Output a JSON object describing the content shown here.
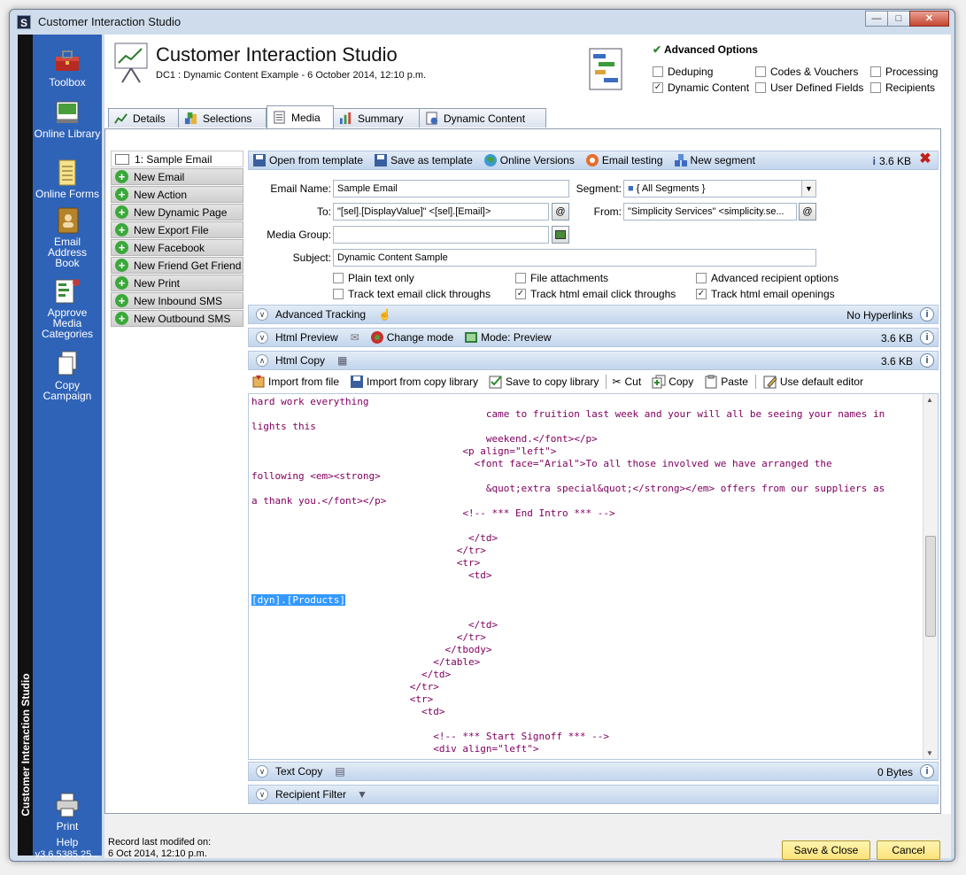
{
  "window": {
    "title": "Customer Interaction Studio"
  },
  "sidebar": {
    "vertical_title": "Customer Interaction Studio",
    "items": [
      {
        "label": "Toolbox",
        "icon": "toolbox-icon"
      },
      {
        "label": "Online Library",
        "icon": "library-icon"
      },
      {
        "label": "Online Forms",
        "icon": "forms-icon"
      },
      {
        "label": "Email Address Book",
        "icon": "address-book-icon"
      },
      {
        "label": "Approve Media Categories",
        "icon": "approve-icon"
      },
      {
        "label": "Copy Campaign",
        "icon": "copy-campaign-icon"
      }
    ],
    "print_label": "Print",
    "help_label": "Help",
    "version": "v3.6.5385.25..."
  },
  "header": {
    "title": "Customer Interaction Studio",
    "subtitle": "DC1 : Dynamic Content Example - 6 October 2014, 12:10 p.m.",
    "advanced_options": {
      "title": "Advanced Options",
      "options": [
        {
          "label": "Deduping",
          "checked": false
        },
        {
          "label": "Codes & Vouchers",
          "checked": false
        },
        {
          "label": "Processing",
          "checked": false
        },
        {
          "label": "Dynamic Content",
          "checked": true
        },
        {
          "label": "User Defined Fields",
          "checked": false
        },
        {
          "label": "Recipients",
          "checked": false
        }
      ]
    }
  },
  "tabs": [
    {
      "label": "Details",
      "active": false
    },
    {
      "label": "Selections",
      "active": false
    },
    {
      "label": "Media",
      "active": true
    },
    {
      "label": "Summary",
      "active": false
    },
    {
      "label": "Dynamic Content",
      "active": false
    }
  ],
  "media_list": [
    {
      "label": "1: Sample Email",
      "selected": true
    },
    {
      "label": "New Email"
    },
    {
      "label": "New Action"
    },
    {
      "label": "New Dynamic Page"
    },
    {
      "label": "New Export File"
    },
    {
      "label": "New Facebook"
    },
    {
      "label": "New Friend Get Friend"
    },
    {
      "label": "New Print"
    },
    {
      "label": "New Inbound SMS"
    },
    {
      "label": "New Outbound SMS"
    }
  ],
  "toolbar": {
    "open_template": "Open from template",
    "save_template": "Save as template",
    "online_versions": "Online Versions",
    "email_testing": "Email testing",
    "new_segment": "New segment",
    "size": "3.6 KB"
  },
  "form": {
    "email_name_label": "Email Name:",
    "email_name": "Sample Email",
    "segment_label": "Segment:",
    "segment": "{ All Segments }",
    "to_label": "To:",
    "to": "\"[sel].[DisplayValue]\" <[sel].[Email]>",
    "from_label": "From:",
    "from": "\"Simplicity Services\" <simplicity.se...",
    "media_group_label": "Media Group:",
    "media_group": "",
    "subject_label": "Subject:",
    "subject": "Dynamic Content Sample",
    "checks": [
      {
        "label": "Plain text only",
        "checked": false
      },
      {
        "label": "File attachments",
        "checked": false
      },
      {
        "label": "Advanced recipient options",
        "checked": false
      },
      {
        "label": "Track text email click throughs",
        "checked": false
      },
      {
        "label": "Track html email click throughs",
        "checked": true
      },
      {
        "label": "Track html email openings",
        "checked": true
      }
    ]
  },
  "sections": {
    "advanced_tracking": {
      "label": "Advanced Tracking",
      "right": "No Hyperlinks"
    },
    "html_preview": {
      "label": "Html Preview",
      "change_mode": "Change mode",
      "mode": "Mode: Preview",
      "right": "3.6 KB"
    },
    "html_copy": {
      "label": "Html Copy",
      "right": "3.6 KB"
    },
    "text_copy": {
      "label": "Text Copy",
      "right": "0 Bytes"
    },
    "recipient_filter": {
      "label": "Recipient Filter"
    }
  },
  "copy_toolbar": {
    "import_file": "Import from file",
    "import_library": "Import from copy library",
    "save_library": "Save to copy library",
    "cut": "Cut",
    "copy": "Copy",
    "paste": "Paste",
    "default_editor": "Use default editor"
  },
  "code_lines": [
    "hard work everything",
    "                                        came to fruition last week and your will all be seeing your names in",
    "lights this",
    "                                        weekend.</font></p>",
    "                                    <p align=\"left\">",
    "                                      <font face=\"Arial\">To all those involved we have arranged the",
    "following <em><strong>",
    "                                        &quot;extra special&quot;</strong></em> offers from our suppliers as",
    "a thank you.</font></p>",
    "                                    <!-- *** End Intro *** -->",
    "",
    "                                     </td>",
    "                                   </tr>",
    "                                   <tr>",
    "                                     <td>",
    "",
    "[dyn].[Products]",
    "",
    "                                     </td>",
    "                                   </tr>",
    "                                 </tbody>",
    "                               </table>",
    "                             </td>",
    "                           </tr>",
    "                           <tr>",
    "                             <td>",
    "",
    "                               <!-- *** Start Signoff *** -->",
    "                               <div align=\"left\">"
  ],
  "status": {
    "record_label": "Record last modifed on:",
    "record_date": "6 Oct 2014, 12:10 p.m.",
    "save_close": "Save & Close",
    "cancel": "Cancel"
  }
}
